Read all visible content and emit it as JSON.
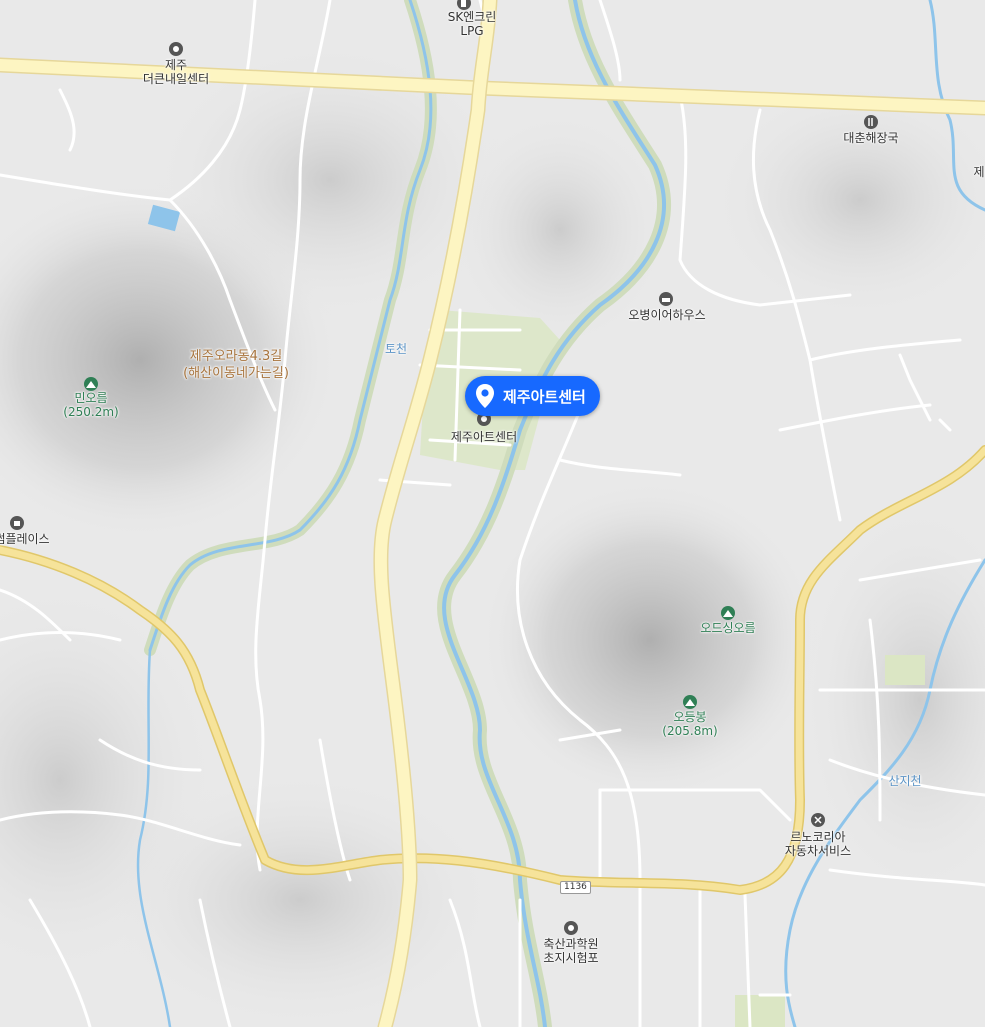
{
  "map": {
    "selected_place": "제주아트센터",
    "colors": {
      "background": "#e9e9e9",
      "road": "#ffffff",
      "major_road": "#f6e39a",
      "highway": "#fdf5c2",
      "water": "#8ec4ea",
      "green": "#dbe6c4",
      "marker": "#1769ff"
    },
    "pois": [
      {
        "name": "SK엔크린",
        "sub": "LPG",
        "icon": "gas-station-icon"
      },
      {
        "name": "제주",
        "sub": "더큰내일센터",
        "icon": "place-icon"
      },
      {
        "name": "대춘해장국",
        "sub": "",
        "icon": "restaurant-icon"
      },
      {
        "name": "오병이어하우스",
        "sub": "",
        "icon": "lodging-icon"
      },
      {
        "name": "제주아트센터",
        "sub": "",
        "icon": "place-icon"
      },
      {
        "name": "썸플레이스",
        "sub": "",
        "icon": "cafe-icon"
      },
      {
        "name": "르노코리아",
        "sub": "자동차서비스",
        "icon": "repair-icon"
      },
      {
        "name": "축산과학원",
        "sub": "초지시험포",
        "icon": "place-icon"
      },
      {
        "name": "제",
        "sub": "",
        "icon": ""
      }
    ],
    "mountains": [
      {
        "name": "민오름",
        "sub": "(250.2m)",
        "icon": "mountain-icon"
      },
      {
        "name": "오드싱오름",
        "sub": "",
        "icon": "mountain-icon"
      },
      {
        "name": "오등봉",
        "sub": "(205.8m)",
        "icon": "mountain-icon"
      }
    ],
    "trail": {
      "line1": "제주오라동4.3길",
      "line2": "(해산이동네가는길)"
    },
    "streams": [
      "토천",
      "산지천"
    ],
    "route_number": "1136"
  }
}
